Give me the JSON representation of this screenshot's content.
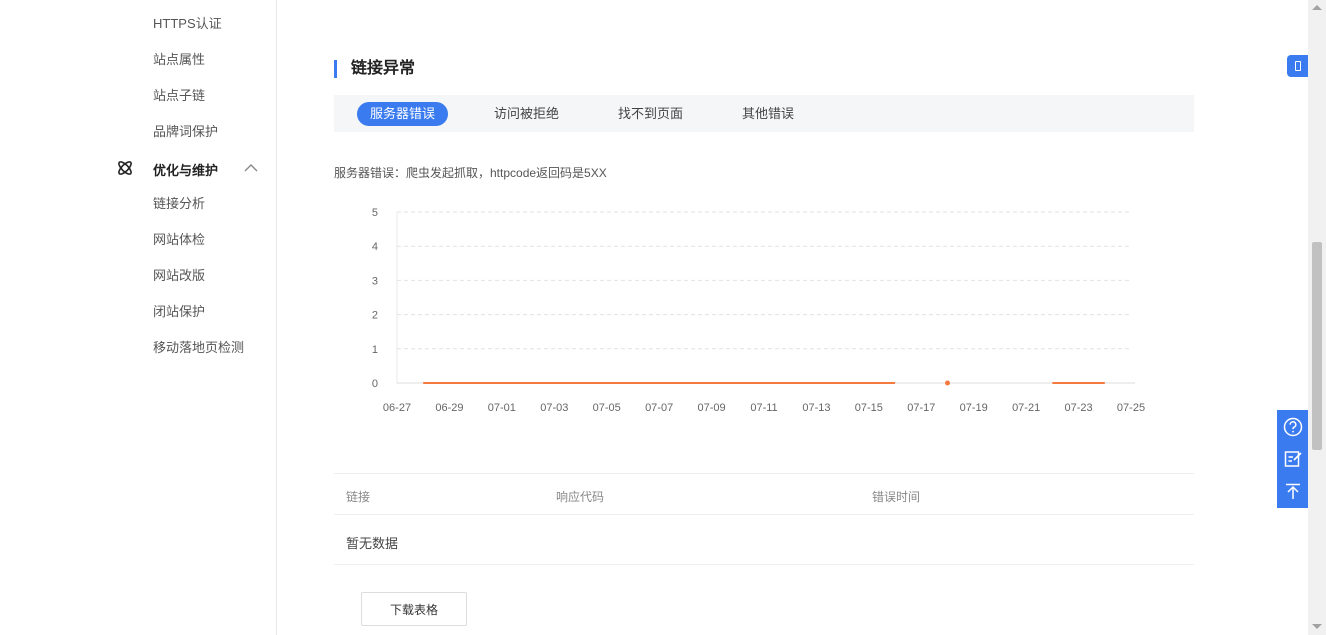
{
  "sidebar": {
    "items_top": [
      "HTTPS认证",
      "站点属性",
      "站点子链",
      "品牌词保护"
    ],
    "group": {
      "label": "优化与维护",
      "icon": "atom-icon",
      "expanded_icon": "chevron-up-icon"
    },
    "group_items": [
      "链接分析",
      "网站体检",
      "网站改版",
      "闭站保护",
      "移动落地页检测"
    ]
  },
  "section": {
    "title": "链接异常",
    "tabs": [
      {
        "label": "服务器错误",
        "active": true
      },
      {
        "label": "访问被拒绝",
        "active": false
      },
      {
        "label": "找不到页面",
        "active": false
      },
      {
        "label": "其他错误",
        "active": false
      }
    ],
    "description": "服务器错误：爬虫发起抓取，httpcode返回码是5XX"
  },
  "chart_data": {
    "type": "line",
    "x": [
      "06-27",
      "06-28",
      "06-29",
      "06-30",
      "07-01",
      "07-02",
      "07-03",
      "07-04",
      "07-05",
      "07-06",
      "07-07",
      "07-08",
      "07-09",
      "07-10",
      "07-11",
      "07-12",
      "07-13",
      "07-14",
      "07-15",
      "07-16",
      "07-17",
      "07-18",
      "07-19",
      "07-20",
      "07-21",
      "07-22",
      "07-23",
      "07-24",
      "07-25"
    ],
    "x_ticks": [
      "06-27",
      "06-29",
      "07-01",
      "07-03",
      "07-05",
      "07-07",
      "07-09",
      "07-11",
      "07-13",
      "07-15",
      "07-17",
      "07-19",
      "07-21",
      "07-23",
      "07-25"
    ],
    "series": [
      {
        "values": [
          null,
          0,
          0,
          0,
          0,
          0,
          0,
          0,
          0,
          0,
          0,
          0,
          0,
          0,
          0,
          0,
          0,
          0,
          0,
          0,
          null,
          0,
          null,
          null,
          null,
          0,
          0,
          0,
          null
        ]
      }
    ],
    "y_ticks": [
      0,
      1,
      2,
      3,
      4,
      5
    ],
    "ylim": [
      0,
      5
    ],
    "grid": true,
    "line_color": "#f47a3f"
  },
  "table": {
    "columns": [
      "链接",
      "响应代码",
      "错误时间"
    ],
    "empty_text": "暂无数据"
  },
  "download_label": "下载表格",
  "float_tools": [
    "question-icon",
    "feedback-icon",
    "back-to-top-icon"
  ],
  "accent_color": "#3a7bef"
}
